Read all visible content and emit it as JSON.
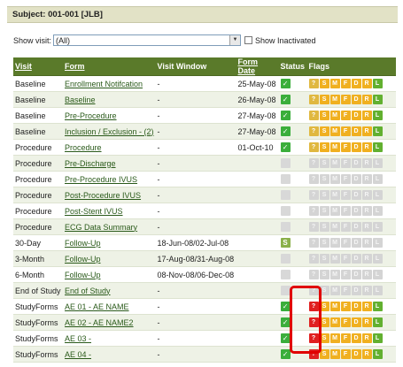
{
  "subject": "Subject: 001-001 [JLB]",
  "show_visit": {
    "label": "Show visit:",
    "value": "(All)",
    "inactive_label": "Show Inactivated"
  },
  "columns": [
    "Visit",
    "Form",
    "Visit Window",
    "Form Date",
    "Status",
    "Flags"
  ],
  "flag_letters": [
    "?",
    "S",
    "M",
    "F",
    "D",
    "R",
    "L"
  ],
  "rows": [
    {
      "visit": "Baseline",
      "form": "Enrollment Notifcation",
      "window": "-",
      "date": "25-May-08",
      "status": "ok",
      "flags": "active"
    },
    {
      "visit": "Baseline",
      "form": "Baseline",
      "window": "-",
      "date": "26-May-08",
      "status": "ok",
      "flags": "active"
    },
    {
      "visit": "Baseline",
      "form": "Pre-Procedure",
      "window": "-",
      "date": "27-May-08",
      "status": "ok",
      "flags": "active"
    },
    {
      "visit": "Baseline",
      "form": "Inclusion / Exclusion - (2)",
      "window": "-",
      "date": "27-May-08",
      "status": "ok",
      "flags": "active"
    },
    {
      "visit": "Procedure",
      "form": "Procedure",
      "window": "-",
      "date": "01-Oct-10",
      "status": "ok",
      "flags": "active"
    },
    {
      "visit": "Procedure",
      "form": "Pre-Discharge",
      "window": "-",
      "date": "",
      "status": "none",
      "flags": "none"
    },
    {
      "visit": "Procedure",
      "form": "Pre-Procedure IVUS",
      "window": "-",
      "date": "",
      "status": "none",
      "flags": "none"
    },
    {
      "visit": "Procedure",
      "form": "Post-Procedure IVUS",
      "window": "-",
      "date": "",
      "status": "none",
      "flags": "none"
    },
    {
      "visit": "Procedure",
      "form": "Post-Stent IVUS",
      "window": "-",
      "date": "",
      "status": "none",
      "flags": "none"
    },
    {
      "visit": "Procedure",
      "form": "ECG Data Summary",
      "window": "-",
      "date": "",
      "status": "none",
      "flags": "none"
    },
    {
      "visit": "30-Day",
      "form": "Follow-Up",
      "window": "18-Jun-08/02-Jul-08",
      "date": "",
      "status": "s",
      "flags": "none"
    },
    {
      "visit": "3-Month",
      "form": "Follow-Up",
      "window": "17-Aug-08/31-Aug-08",
      "date": "",
      "status": "none",
      "flags": "none"
    },
    {
      "visit": "6-Month",
      "form": "Follow-Up",
      "window": "08-Nov-08/06-Dec-08",
      "date": "",
      "status": "none",
      "flags": "none"
    },
    {
      "visit": "End of Study",
      "form": "End of Study",
      "window": "-",
      "date": "",
      "status": "none",
      "flags": "none"
    },
    {
      "visit": "StudyForms",
      "form": "AE 01 - AE NAME",
      "window": "-",
      "date": "",
      "status": "ok",
      "flags": "query"
    },
    {
      "visit": "StudyForms",
      "form": "AE 02 - AE NAME2",
      "window": "-",
      "date": "",
      "status": "ok",
      "flags": "query"
    },
    {
      "visit": "StudyForms",
      "form": "AE 03 -",
      "window": "-",
      "date": "",
      "status": "ok",
      "flags": "query"
    },
    {
      "visit": "StudyForms",
      "form": "AE 04 -",
      "window": "-",
      "date": "",
      "status": "ok",
      "flags": "query"
    }
  ]
}
